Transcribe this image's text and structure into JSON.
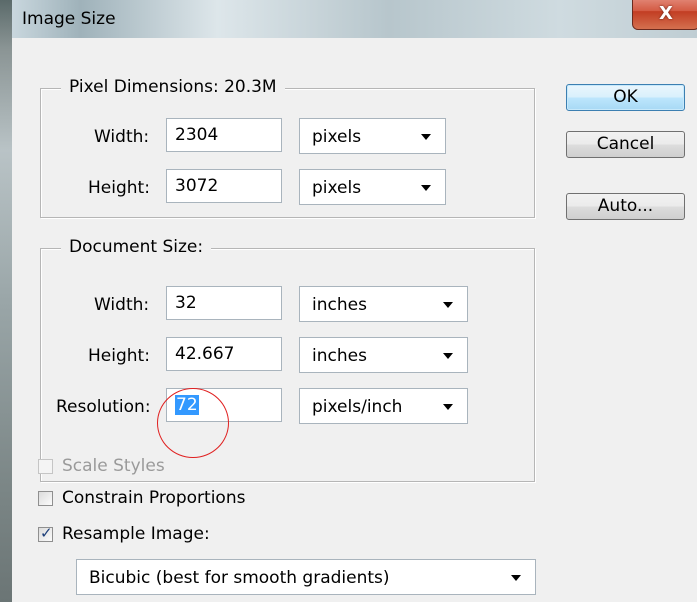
{
  "window": {
    "title": "Image Size",
    "close_glyph": "X"
  },
  "pixel_dimensions": {
    "legend": "Pixel Dimensions:  20.3M",
    "width_label": "Width:",
    "width_value": "2304",
    "width_unit": "pixels",
    "height_label": "Height:",
    "height_value": "3072",
    "height_unit": "pixels"
  },
  "document_size": {
    "legend": "Document Size:",
    "width_label": "Width:",
    "width_value": "32",
    "width_unit": "inches",
    "height_label": "Height:",
    "height_value": "42.667",
    "height_unit": "inches",
    "resolution_label": "Resolution:",
    "resolution_value": "72",
    "resolution_unit": "pixels/inch"
  },
  "buttons": {
    "ok": "OK",
    "cancel": "Cancel",
    "auto": "Auto..."
  },
  "options": {
    "scale_styles": {
      "label": "Scale Styles",
      "checked": false,
      "enabled": false
    },
    "constrain_proportions": {
      "label": "Constrain Proportions",
      "checked": false,
      "enabled": true
    },
    "resample_image": {
      "label": "Resample Image:",
      "checked": true,
      "enabled": true
    },
    "resample_method": "Bicubic (best for smooth gradients)"
  },
  "colors": {
    "selection": "#3399ff",
    "annotation": "#e02020",
    "close_button": "#c23d23"
  }
}
